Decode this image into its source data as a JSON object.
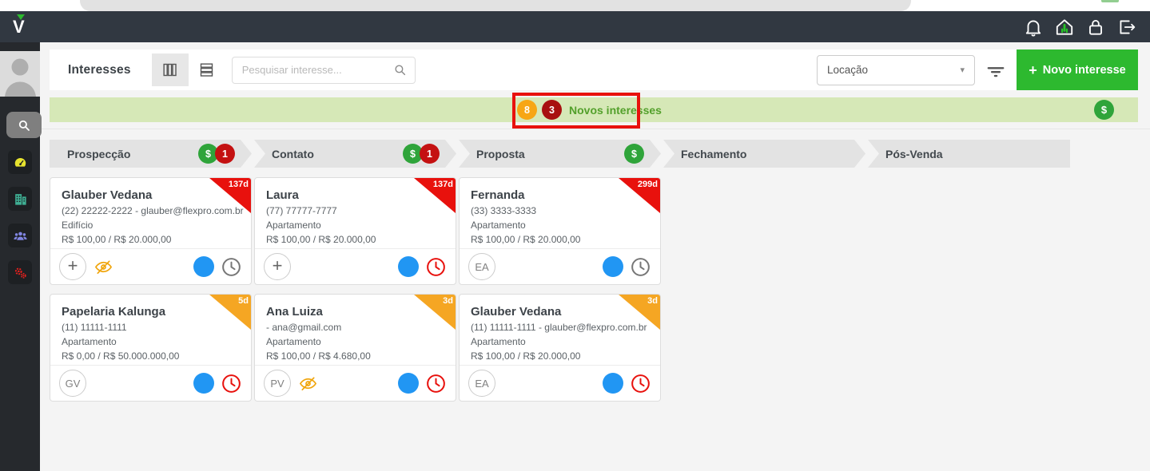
{
  "topbar": {
    "logo": "V",
    "icons": [
      "notifications-bell",
      "home-touch",
      "lock",
      "logout"
    ]
  },
  "sidebar": {
    "icons": [
      {
        "name": "dashboard-gauge-icon",
        "color": "#e7e32f"
      },
      {
        "name": "properties-building-icon",
        "color": "#3fae93"
      },
      {
        "name": "clients-users-icon",
        "color": "#8186e3"
      },
      {
        "name": "settings-gears-icon",
        "color": "#e5201d"
      }
    ]
  },
  "toolbar": {
    "title": "Interesses",
    "search_placeholder": "Pesquisar interesse...",
    "category_value": "Locação",
    "new_interest_label": "Novo interesse"
  },
  "banner": {
    "pending_count": "8",
    "overdue_count": "3",
    "label": "Novos interesses"
  },
  "glyphs": {
    "dollar": "$",
    "plus": "+",
    "caret_down": "▾"
  },
  "colors": {
    "banner_bg": "#d6e8b7",
    "banner_text_green": "#53a02b",
    "badge_orange": "#f7a614",
    "badge_dark_red": "#a8100f",
    "badge_green": "#2fa43a",
    "badge_bright_red": "#c41111",
    "button_green": "#2db92f",
    "highlight_box_red": "#e8110d",
    "blue_dot": "#2196f3",
    "ribbon_red": "#e8110d",
    "ribbon_orange": "#f5a623"
  },
  "stages": [
    {
      "label": "Prospecção",
      "dollar": true,
      "count": "1"
    },
    {
      "label": "Contato",
      "dollar": true,
      "count": "1"
    },
    {
      "label": "Proposta",
      "dollar": true,
      "count": ""
    },
    {
      "label": "Fechamento",
      "dollar": false,
      "count": ""
    },
    {
      "label": "Pós-Venda",
      "dollar": false,
      "count": ""
    }
  ],
  "cards": [
    {
      "col": 0,
      "ribbon": "137d",
      "ribbon_color": "#e8110d",
      "name": "Glauber Vedana",
      "contact": "(22) 22222-2222 - glauber@flexpro.com.br",
      "property": "Edifício",
      "values": "R$  100,00 / R$  20.000,00",
      "avatar": "+",
      "eye_slash": true,
      "clock": "gray"
    },
    {
      "col": 1,
      "ribbon": "137d",
      "ribbon_color": "#e8110d",
      "name": "Laura",
      "contact": "(77) 77777-7777",
      "property": "Apartamento",
      "values": "R$  100,00 / R$  20.000,00",
      "avatar": "+",
      "eye_slash": false,
      "clock": "red"
    },
    {
      "col": 2,
      "ribbon": "299d",
      "ribbon_color": "#e8110d",
      "name": "Fernanda",
      "contact": "(33) 3333-3333",
      "property": "Apartamento",
      "values": "R$  100,00 / R$  20.000,00",
      "avatar": "EA",
      "eye_slash": false,
      "clock": "gray"
    },
    {
      "col": 0,
      "ribbon": "5d",
      "ribbon_color": "#f5a623",
      "name": "Papelaria Kalunga",
      "contact": "(11) 11111-1111",
      "property": "Apartamento",
      "values": "R$  0,00 / R$  50.000.000,00",
      "avatar": "GV",
      "eye_slash": false,
      "clock": "red"
    },
    {
      "col": 1,
      "ribbon": "3d",
      "ribbon_color": "#f5a623",
      "name": "Ana Luiza",
      "contact": "- ana@gmail.com",
      "property": "Apartamento",
      "values": "R$  100,00 / R$  4.680,00",
      "avatar": "PV",
      "eye_slash": true,
      "clock": "red"
    },
    {
      "col": 2,
      "ribbon": "3d",
      "ribbon_color": "#f5a623",
      "name": "Glauber Vedana",
      "contact": "(11) 11111-1111 - glauber@flexpro.com.br",
      "property": "Apartamento",
      "values": "R$  100,00 / R$  20.000,00",
      "avatar": "EA",
      "eye_slash": false,
      "clock": "red"
    }
  ]
}
